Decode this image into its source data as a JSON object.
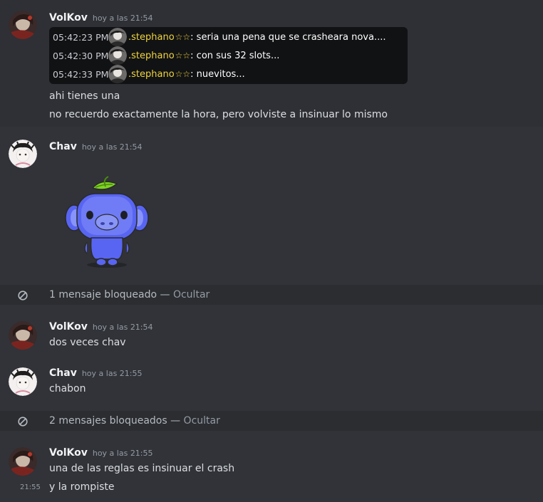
{
  "messages": [
    {
      "author": "VolKov",
      "time": "hoy a las 21:54",
      "embed": [
        {
          "time": "05:42:23 PM",
          "name": ".stephano",
          "stars": "☆☆",
          "text": ": seria una pena que se crasheara nova...."
        },
        {
          "time": "05:42:30 PM",
          "name": ".stephano",
          "stars": "☆☆",
          "text": ": con sus 32 slots..."
        },
        {
          "time": "05:42:33 PM",
          "name": ".stephano",
          "stars": "☆☆",
          "text": ": nuevitos..."
        }
      ],
      "lines": [
        "ahi tienes una",
        "no recuerdo exactamente la hora, pero volviste a insinuar lo mismo"
      ]
    },
    {
      "author": "Chav",
      "time": "hoy a las 21:54",
      "sticker": "wumpus-sticker"
    },
    {
      "blocked_text": "1 mensaje bloqueado — ",
      "blocked_link": "Ocultar"
    },
    {
      "author": "VolKov",
      "time": "hoy a las 21:54",
      "lines": [
        "dos veces chav"
      ]
    },
    {
      "author": "Chav",
      "time": "hoy a las 21:55",
      "lines": [
        "chabon"
      ]
    },
    {
      "blocked_text": "2 mensajes bloqueados — ",
      "blocked_link": "Ocultar"
    },
    {
      "author": "VolKov",
      "time": "hoy a las 21:55",
      "lines": [
        "una de las reglas es insinuar el crash",
        "y la rompiste"
      ],
      "hover_time": "21:55"
    }
  ],
  "colors": {
    "background": "#313338",
    "username": "#f2f3f5",
    "embed_name": "#f0d53f",
    "blocked_bg": "#2b2d31"
  },
  "icons": {
    "blocked": "blocked-circle-icon"
  }
}
